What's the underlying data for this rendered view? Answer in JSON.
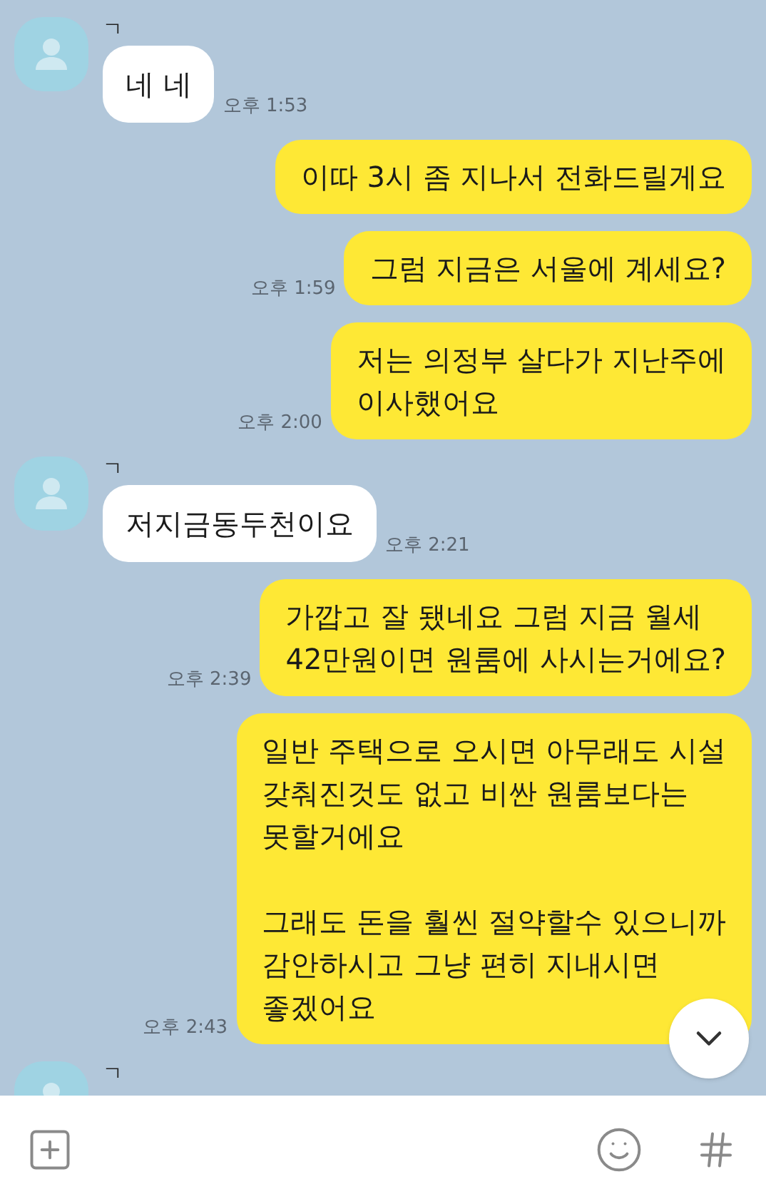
{
  "messages": [
    {
      "kind": "received",
      "name": "ㄱ",
      "text": "네 네",
      "time": "오후 1:53"
    },
    {
      "kind": "sent",
      "text": "이따 3시 좀 지나서 전화드릴게요"
    },
    {
      "kind": "sent",
      "text": "그럼 지금은 서울에 계세요?",
      "time": "오후 1:59"
    },
    {
      "kind": "sent",
      "text": "저는 의정부 살다가 지난주에\n이사했어요",
      "time": "오후 2:00"
    },
    {
      "kind": "received",
      "name": "ㄱ",
      "text": "저지금동두천이요",
      "time": "오후 2:21"
    },
    {
      "kind": "sent",
      "text": "가깝고 잘 됐네요 그럼 지금 월세\n42만원이면 원룸에 사시는거에요?",
      "time": "오후 2:39"
    },
    {
      "kind": "sent",
      "text": "일반 주택으로 오시면 아무래도 시설\n갖춰진것도 없고 비싼 원룸보다는\n못할거에요\n\n그래도 돈을 훨씬 절약할수 있으니까\n감안하시고 그냥 편히 지내시면\n좋겠어요",
      "time": "오후 2:43"
    },
    {
      "kind": "received",
      "name": "ㄱ"
    }
  ]
}
